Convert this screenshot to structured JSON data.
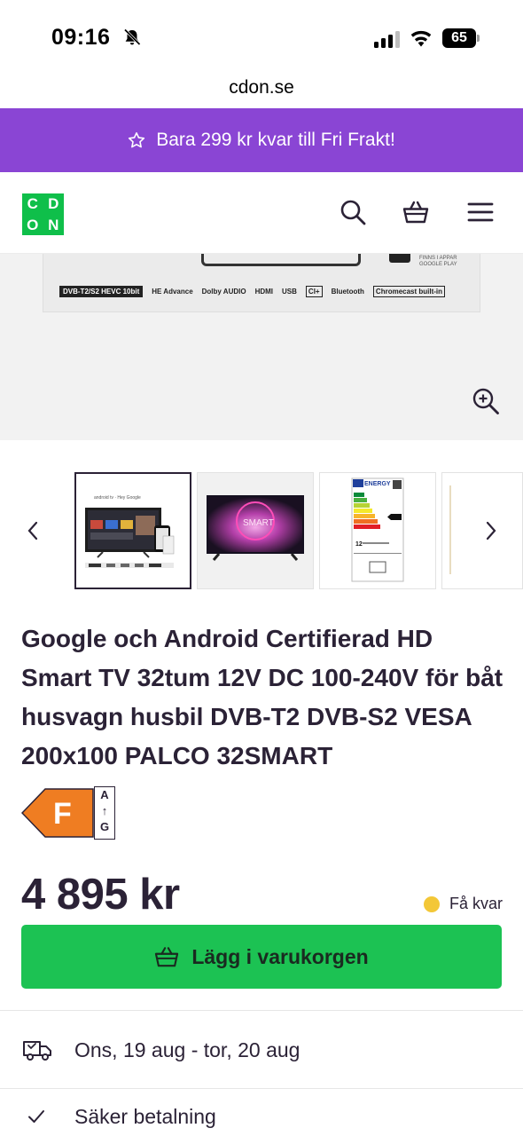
{
  "status_bar": {
    "time": "09:16",
    "battery": "65"
  },
  "browser": {
    "url": "cdon.se"
  },
  "promo": {
    "text": "Bara 299 kr kvar till Fri Frakt!"
  },
  "header": {
    "logo_letters": [
      "C",
      "D",
      "O",
      "N"
    ]
  },
  "hero": {
    "tag_line1": "FINNS I APPAR",
    "tag_line2": "GOOGLE PLAY",
    "feature_logos": [
      "DVB-T2/S2 HEVC 10bit",
      "HE Advance",
      "Dolby AUDIO",
      "HDMI",
      "USB",
      "CI+",
      "Bluetooth",
      "Chromecast built-in"
    ]
  },
  "thumbnails": {
    "thumb2_text": "SMART",
    "energy_label_text": "ENERGY",
    "energy_kwh": "12"
  },
  "product": {
    "title": "Google och Android Certifierad HD Smart TV 32tum 12V DC 100-240V för båt husvagn husbil DVB-T2 DVB-S2 VESA 200x100 PALCO 32SMART",
    "energy_class": "F",
    "energy_scale_top": "A",
    "energy_scale_arrow": "↑",
    "energy_scale_bottom": "G",
    "price": "4 895 kr",
    "stock_status": "Få kvar",
    "add_to_cart": "Lägg i varukorgen"
  },
  "info": {
    "delivery": "Ons, 19 aug - tor, 20 aug",
    "payment": "Säker betalning"
  },
  "colors": {
    "promo_bg": "#8a45d4",
    "logo_green": "#0fbf4a",
    "cta_green": "#1cc253",
    "energy_orange": "#ef7d22",
    "stock_yellow": "#f3c737",
    "text_dark": "#2b2236"
  }
}
